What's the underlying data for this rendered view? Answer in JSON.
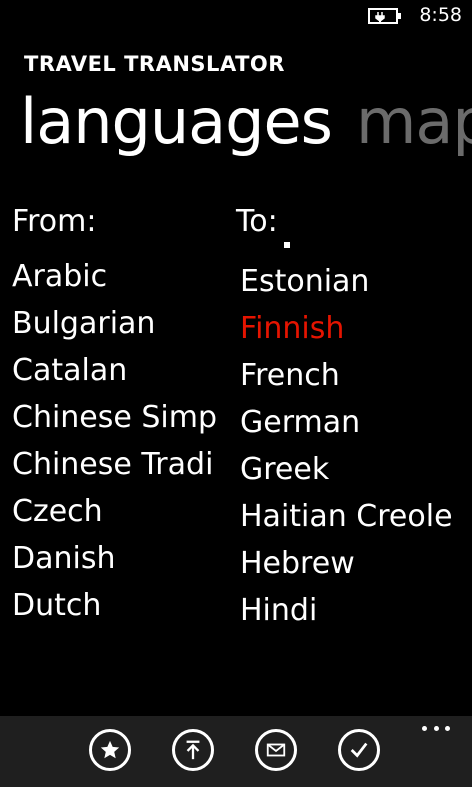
{
  "status_bar": {
    "time": "8:58",
    "battery_icon": "battery-charging-icon"
  },
  "app": {
    "title": "TRAVEL TRANSLATOR"
  },
  "pivot": {
    "items": [
      {
        "label": "languages",
        "active": true
      },
      {
        "label": "map",
        "active": false
      }
    ]
  },
  "from": {
    "header": "From:",
    "items": [
      "Arabic",
      "Bulgarian",
      "Catalan",
      "Chinese Simp",
      "Chinese Tradi",
      "Czech",
      "Danish",
      "Dutch"
    ]
  },
  "to": {
    "header": "To:",
    "items": [
      "Estonian",
      "Finnish",
      "French",
      "German",
      "Greek",
      "Haitian Creole",
      "Hebrew",
      "Hindi"
    ],
    "selected": "Finnish"
  },
  "app_bar": {
    "buttons": [
      {
        "icon": "star-icon"
      },
      {
        "icon": "upload-icon"
      },
      {
        "icon": "mail-icon"
      },
      {
        "icon": "check-icon"
      }
    ],
    "more_icon": "more-icon"
  },
  "colors": {
    "accent": "#e51400",
    "inactive_pivot": "#6b6b6b",
    "app_bar_bg": "#1f1f1f"
  }
}
